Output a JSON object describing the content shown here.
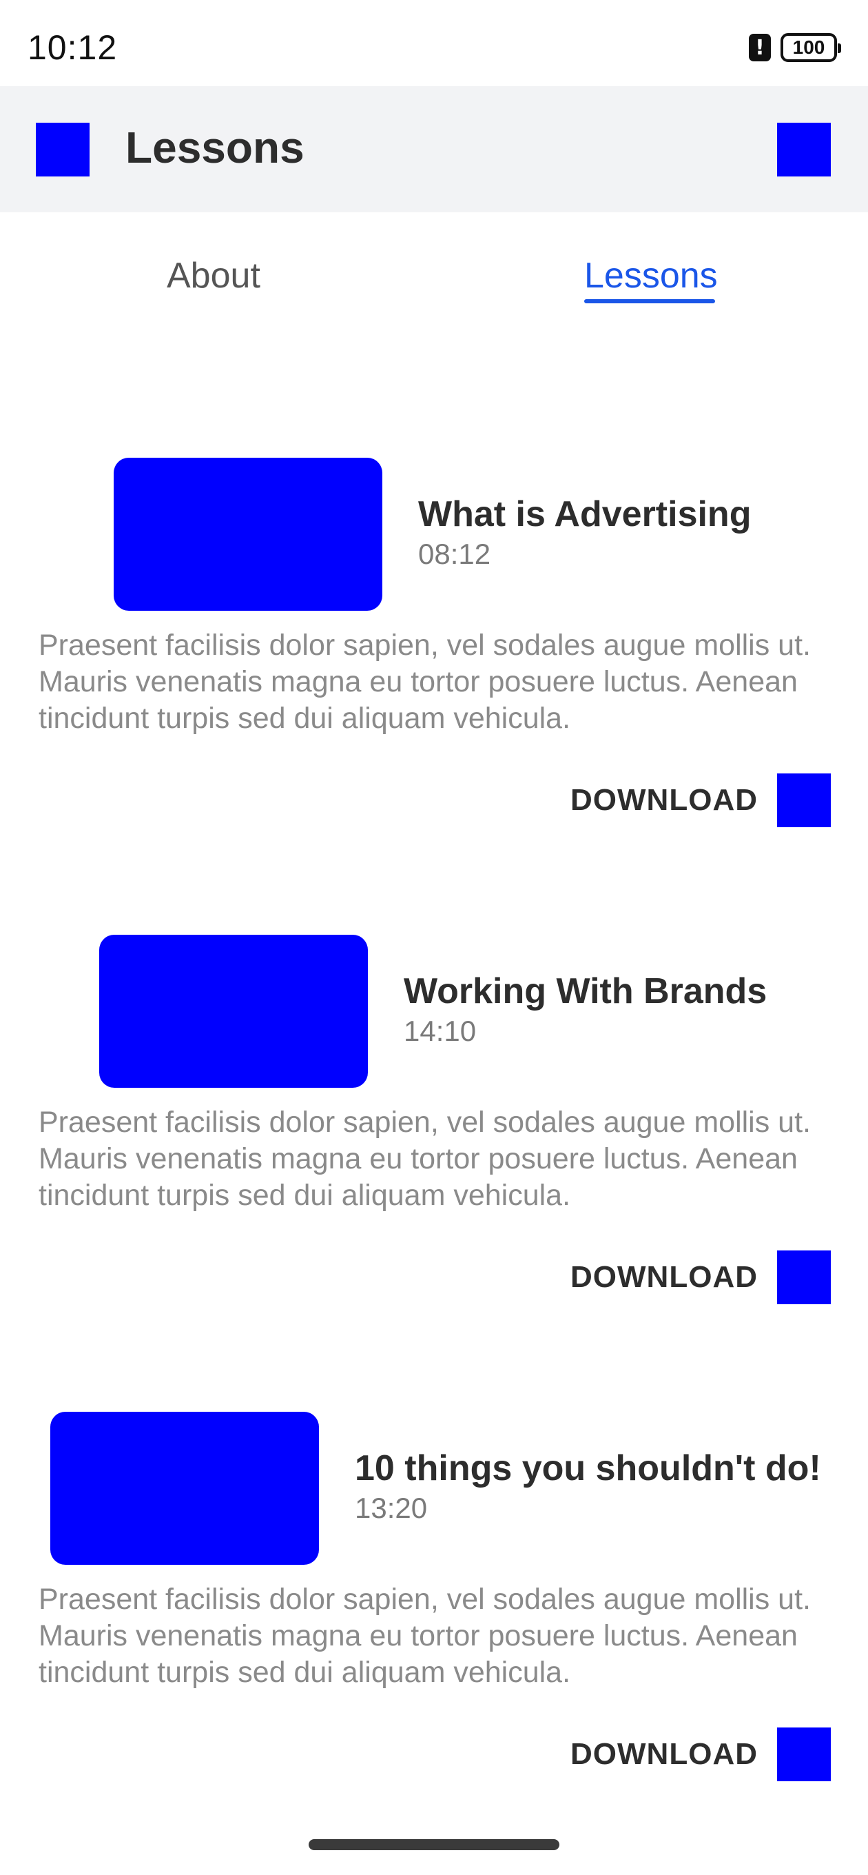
{
  "status_bar": {
    "time": "10:12",
    "battery": "100"
  },
  "app_bar": {
    "title": "Lessons",
    "menu_icon": "menu-icon",
    "action_icon": "action-icon"
  },
  "tabs": [
    {
      "label": "About",
      "active": false
    },
    {
      "label": "Lessons",
      "active": true
    }
  ],
  "lessons": [
    {
      "title": "What is Advertising",
      "duration": "08:12",
      "description": "Praesent facilisis dolor sapien, vel sodales augue mollis ut. Mauris venenatis magna eu tortor posuere luctus. Aenean tincidunt turpis sed dui aliquam vehicula.",
      "download_label": "DOWNLOAD"
    },
    {
      "title": "Working With Brands",
      "duration": "14:10",
      "description": "Praesent facilisis dolor sapien, vel sodales augue mollis ut. Mauris venenatis magna eu tortor posuere luctus. Aenean tincidunt turpis sed dui aliquam vehicula.",
      "download_label": "DOWNLOAD"
    },
    {
      "title": "10 things you shouldn't do!",
      "duration": "13:20",
      "description": "Praesent facilisis dolor sapien, vel sodales augue mollis ut. Mauris venenatis magna eu tortor posuere luctus. Aenean tincidunt turpis sed dui aliquam vehicula.",
      "download_label": "DOWNLOAD"
    }
  ],
  "colors": {
    "accent": "#1a56e8",
    "placeholder": "#0000ff",
    "app_bar_bg": "#f2f3f5"
  }
}
